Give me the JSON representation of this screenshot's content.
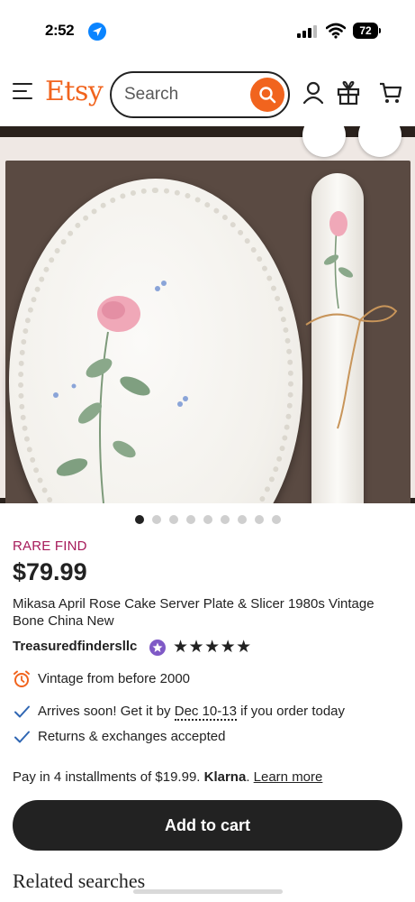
{
  "status_bar": {
    "time": "2:52",
    "battery": "72"
  },
  "header": {
    "logo": "Etsy",
    "search_placeholder": "Search"
  },
  "carousel": {
    "total": 9,
    "active_index": 0
  },
  "product": {
    "badge": "RARE FIND",
    "price": "$79.99",
    "title": "Mikasa April Rose Cake Server Plate & Slicer 1980s Vintage Bone China New",
    "shop_name": "Treasuredfindersllc",
    "rating_stars": "★★★★★",
    "rating": 5
  },
  "details": {
    "vintage": "Vintage from before 2000",
    "arrives_prefix": "Arrives soon! Get it by ",
    "arrives_dates": "Dec 10-13",
    "arrives_suffix": " if you order today",
    "returns": "Returns & exchanges accepted"
  },
  "payment": {
    "prefix": "Pay in 4 installments of $19.99. ",
    "provider": "Klarna",
    "provider_suffix": ".",
    "learn_more": "Learn more"
  },
  "actions": {
    "add_to_cart": "Add to cart"
  },
  "sections": {
    "related_searches": "Related searches"
  },
  "colors": {
    "brand": "#f1641e",
    "rare_find": "#a61a5a",
    "star_seller": "#7f59c6",
    "check": "#2f66b3",
    "cart_button": "#222222"
  },
  "icons": [
    "location-arrow-icon",
    "signal-icon",
    "wifi-icon",
    "battery-icon",
    "menu-icon",
    "search-icon",
    "account-icon",
    "gift-icon",
    "cart-icon",
    "star-seller-icon",
    "alarm-clock-icon",
    "check-icon"
  ]
}
